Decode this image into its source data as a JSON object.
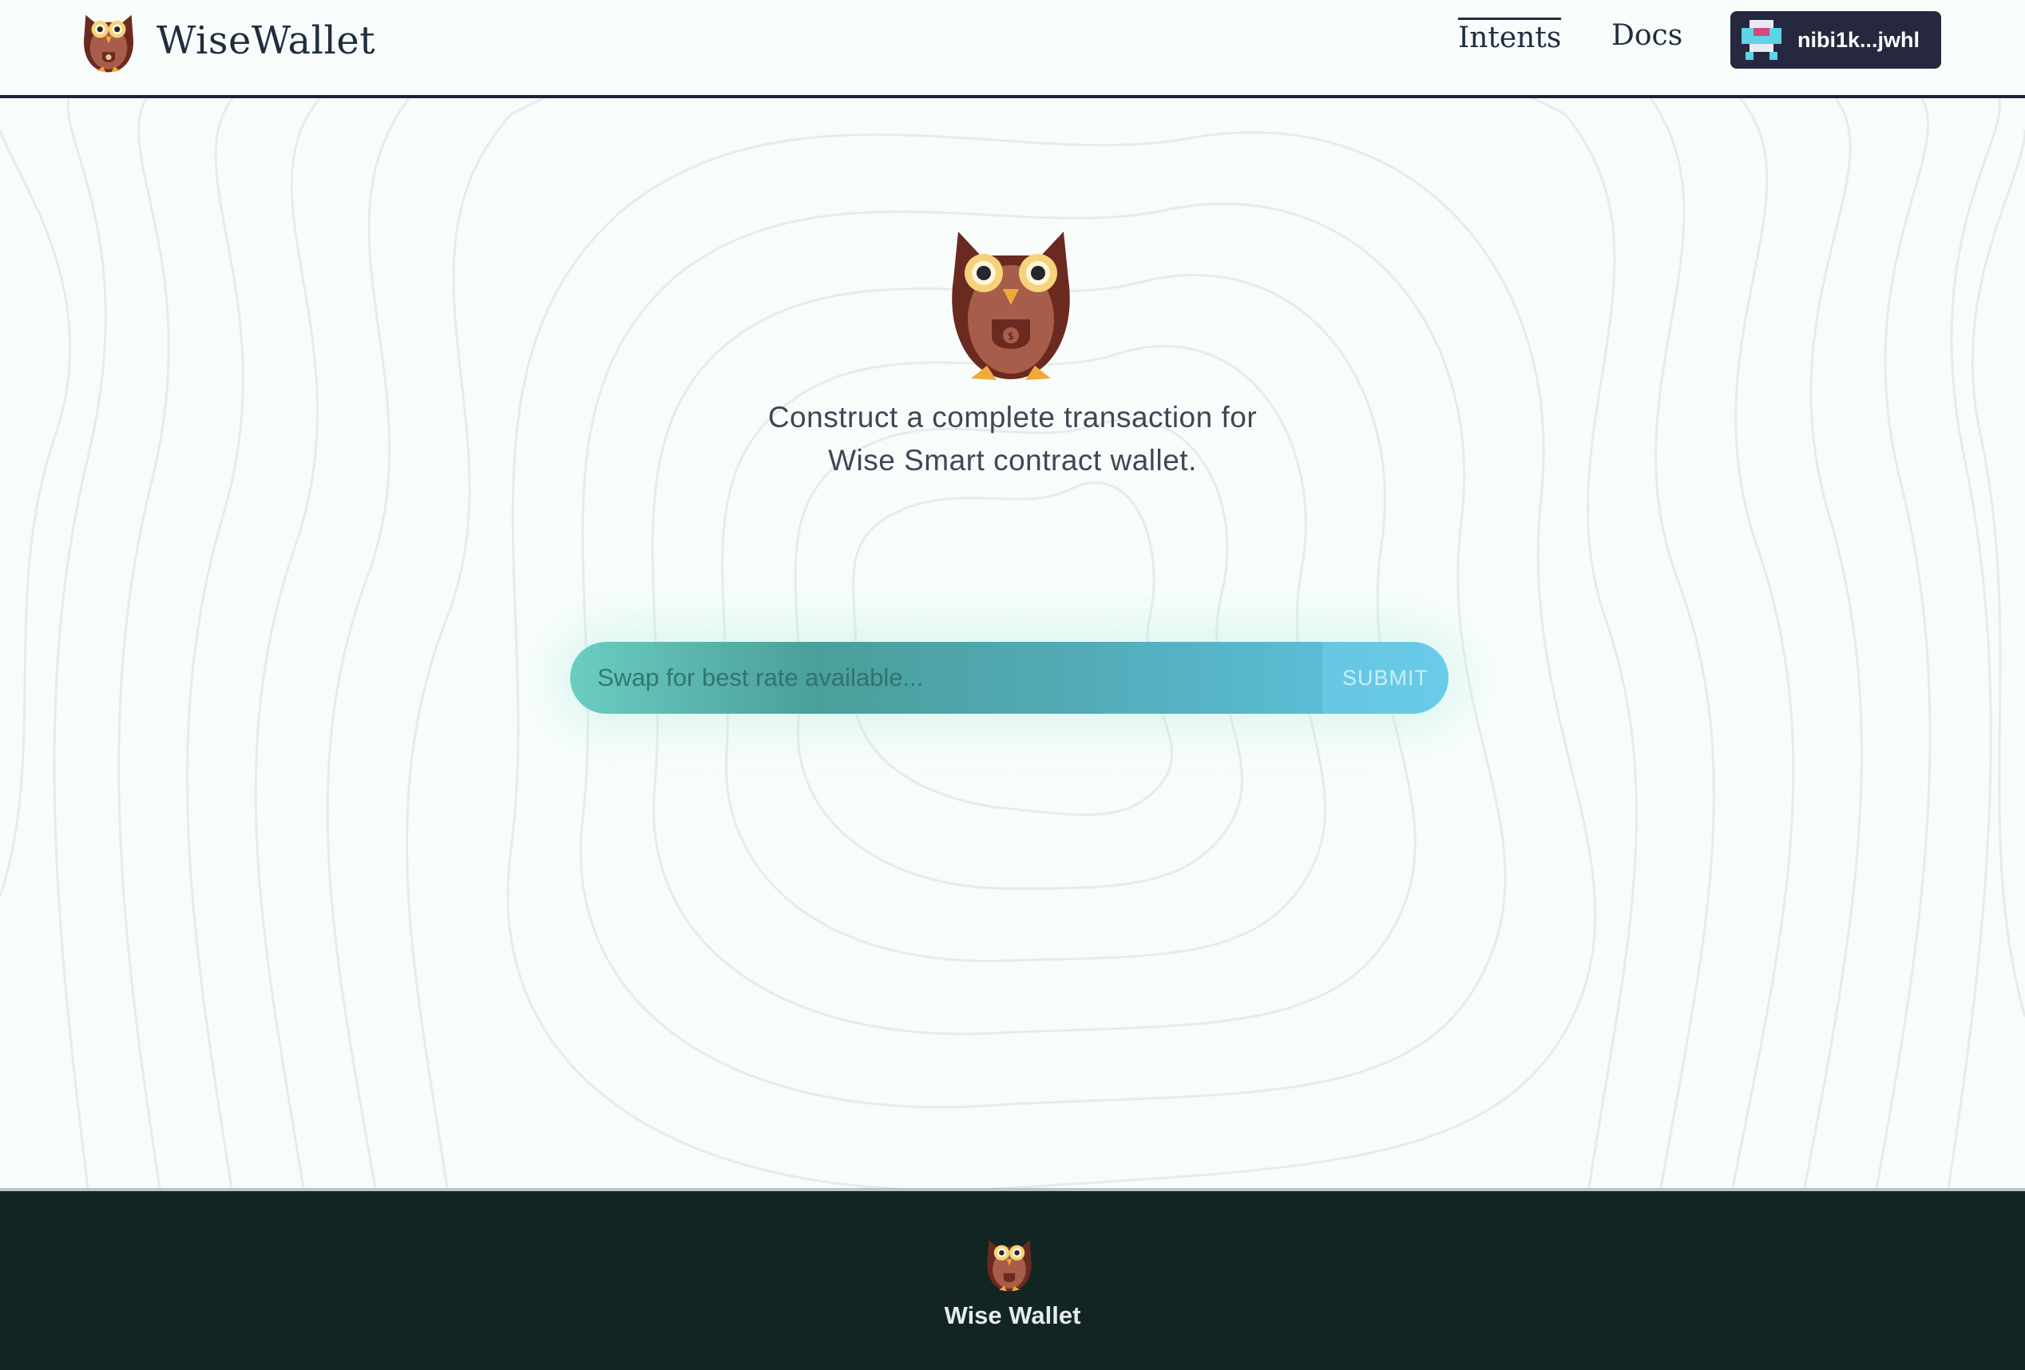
{
  "header": {
    "brand_name": "WiseWallet",
    "nav": [
      {
        "label": "Intents",
        "active": true
      },
      {
        "label": "Docs",
        "active": false
      }
    ],
    "wallet": {
      "address": "nibi1k...jwhl",
      "avatar_icon": "identicon-avatar"
    }
  },
  "hero": {
    "icon": "owl-wallet-mascot-icon",
    "tagline_line1": "Construct a complete transaction for",
    "tagline_line2": "Wise Smart contract wallet."
  },
  "intent": {
    "placeholder": "Swap for best rate available...",
    "value": "",
    "submit_label": "SUBMIT"
  },
  "footer": {
    "brand_name": "Wise Wallet",
    "icon": "owl-logo-icon"
  },
  "colors": {
    "page_bg": "#f8fdfc",
    "header_border": "#1e2235",
    "wallet_button": "#26283f",
    "footer_bg": "#122523",
    "gradient_start": "#6bcdc0",
    "gradient_end": "#5ec6e5"
  }
}
